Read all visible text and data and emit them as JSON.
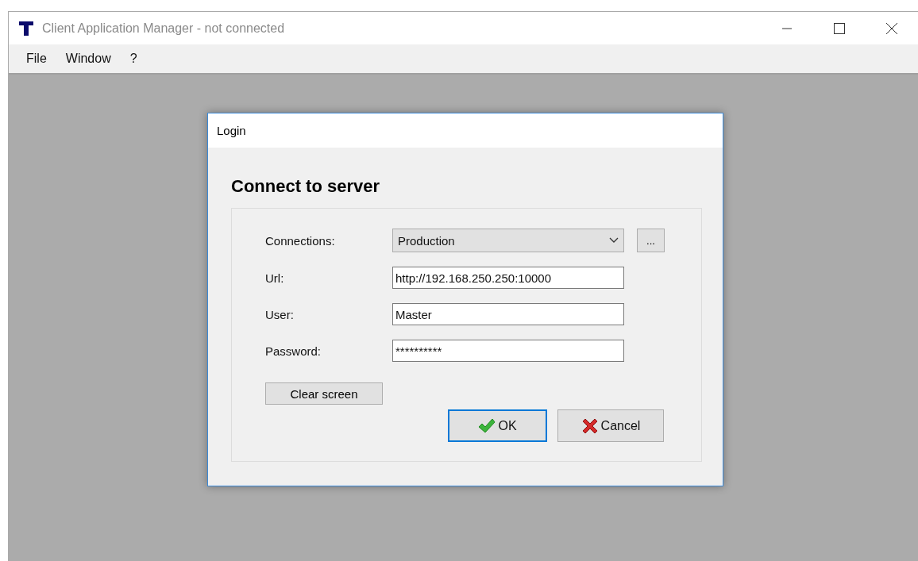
{
  "window": {
    "title": "Client Application Manager - not connected"
  },
  "menu": [
    "File",
    "Window",
    "?"
  ],
  "dialog": {
    "title": "Login",
    "heading": "Connect to server",
    "fields": [
      {
        "kind": "combo",
        "label": "Connections:",
        "value": "Production",
        "extra": "..."
      },
      {
        "kind": "text",
        "label": "Url:",
        "value": "http://192.168.250.250:10000"
      },
      {
        "kind": "text",
        "label": "User:",
        "value": "Master"
      },
      {
        "kind": "password",
        "label": "Password:",
        "value": "**********"
      }
    ],
    "clear_button": "Clear screen",
    "buttons": [
      {
        "kind": "ok",
        "label": "OK",
        "selected": true
      },
      {
        "kind": "cancel",
        "label": "Cancel",
        "selected": false
      }
    ]
  }
}
